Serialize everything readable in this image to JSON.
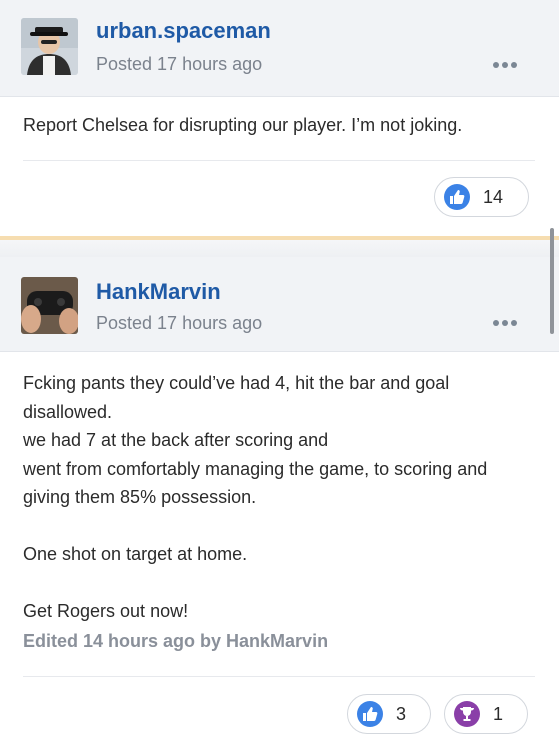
{
  "posts": [
    {
      "author": "urban.spaceman",
      "posted": "Posted 17 hours ago",
      "body": [
        "Report Chelsea for disrupting our player. I’m not joking."
      ],
      "reactions": [
        {
          "icon": "like-icon",
          "count": "14",
          "color": "#3b82e6"
        }
      ]
    },
    {
      "author": "HankMarvin",
      "posted": "Posted 17 hours ago",
      "body": [
        "Fcking pants they could’ve had 4, hit the bar and goal disallowed.",
        "we had 7 at the back after scoring and",
        "went from comfortably managing the game, to scoring and giving them 85% possession.",
        "",
        "One shot on target at home.",
        "",
        "Get Rogers out now!"
      ],
      "edited": "Edited 14 hours ago by HankMarvin",
      "reactions": [
        {
          "icon": "like-icon",
          "count": "3",
          "color": "#3b82e6"
        },
        {
          "icon": "trophy-icon",
          "count": "1",
          "color": "#8a3fa8"
        }
      ]
    }
  ],
  "colors": {
    "accent": "#1f5aa6",
    "header_bg": "#f1f3f6",
    "separator": "#f6ddb0"
  }
}
